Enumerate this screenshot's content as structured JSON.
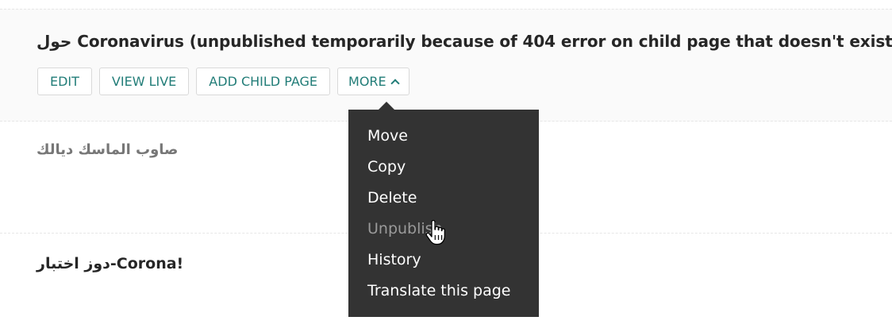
{
  "pages": [
    {
      "title": "حول Coronavirus (unpublished temporarily because of 404 error on child page that doesn't exist)",
      "actions": {
        "edit": "EDIT",
        "view_live": "VIEW LIVE",
        "add_child": "ADD CHILD PAGE",
        "more": "MORE"
      }
    },
    {
      "title": "صاوب الماسك ديالك"
    },
    {
      "title": "دوز اختبار-Corona!"
    }
  ],
  "more_menu": {
    "items": [
      {
        "label": "Move",
        "state": "enabled"
      },
      {
        "label": "Copy",
        "state": "enabled"
      },
      {
        "label": "Delete",
        "state": "enabled"
      },
      {
        "label": "Unpublish",
        "state": "hovered"
      },
      {
        "label": "History",
        "state": "enabled"
      },
      {
        "label": "Translate this page",
        "state": "enabled"
      }
    ]
  },
  "colors": {
    "accent": "#227d78",
    "menu_bg": "#333333",
    "row_highlight": "#fafafa"
  },
  "icons": {
    "more_chevron": "chevron-up-icon",
    "pointer": "hand-pointer-icon"
  }
}
